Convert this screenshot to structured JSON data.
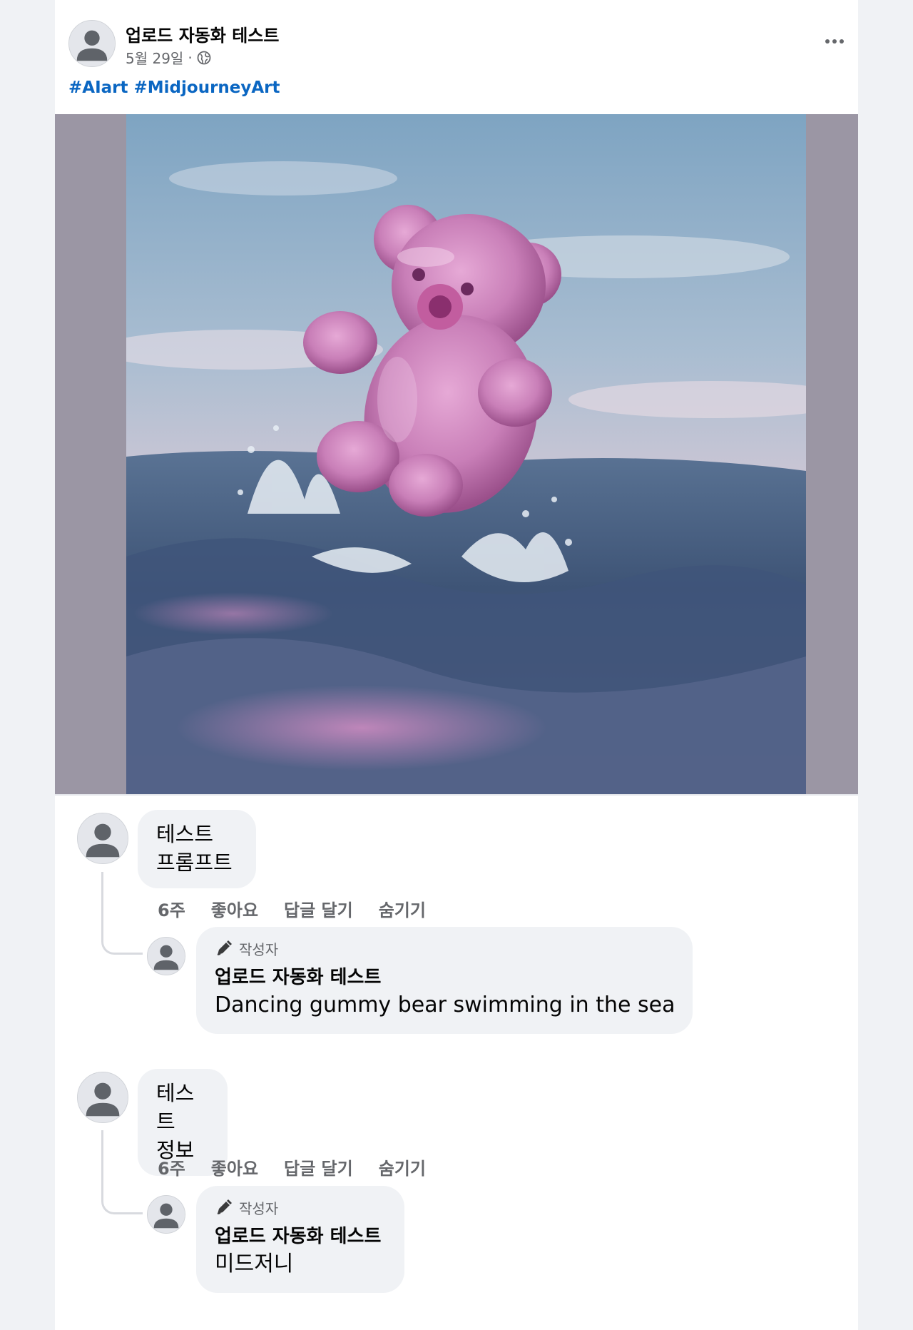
{
  "post": {
    "author": "업로드 자동화 테스트",
    "date": "5월 29일",
    "separator": "·",
    "privacy_icon": "globe-icon",
    "more_icon": "more-horizontal-icon",
    "hashtags": [
      "#AIart",
      "#MidjourneyArt"
    ]
  },
  "comments": [
    {
      "text": "테스트\n프롬프트",
      "time": "6주",
      "like": "좋아요",
      "reply": "답글 달기",
      "hide": "숨기기",
      "reply_item": {
        "badge": "작성자",
        "author": "업로드 자동화 테스트",
        "text": "Dancing gummy bear swimming in the sea"
      }
    },
    {
      "text": "테스트\n정보",
      "time": "6주",
      "like": "좋아요",
      "reply": "답글 달기",
      "hide": "숨기기",
      "reply_item": {
        "badge": "작성자",
        "author": "업로드 자동화 테스트",
        "text": "미드저니"
      }
    }
  ],
  "colors": {
    "link": "#0a66c2",
    "bubble": "#f0f2f5",
    "secondary_text": "#65676b",
    "page_bg": "#f0f2f5"
  }
}
